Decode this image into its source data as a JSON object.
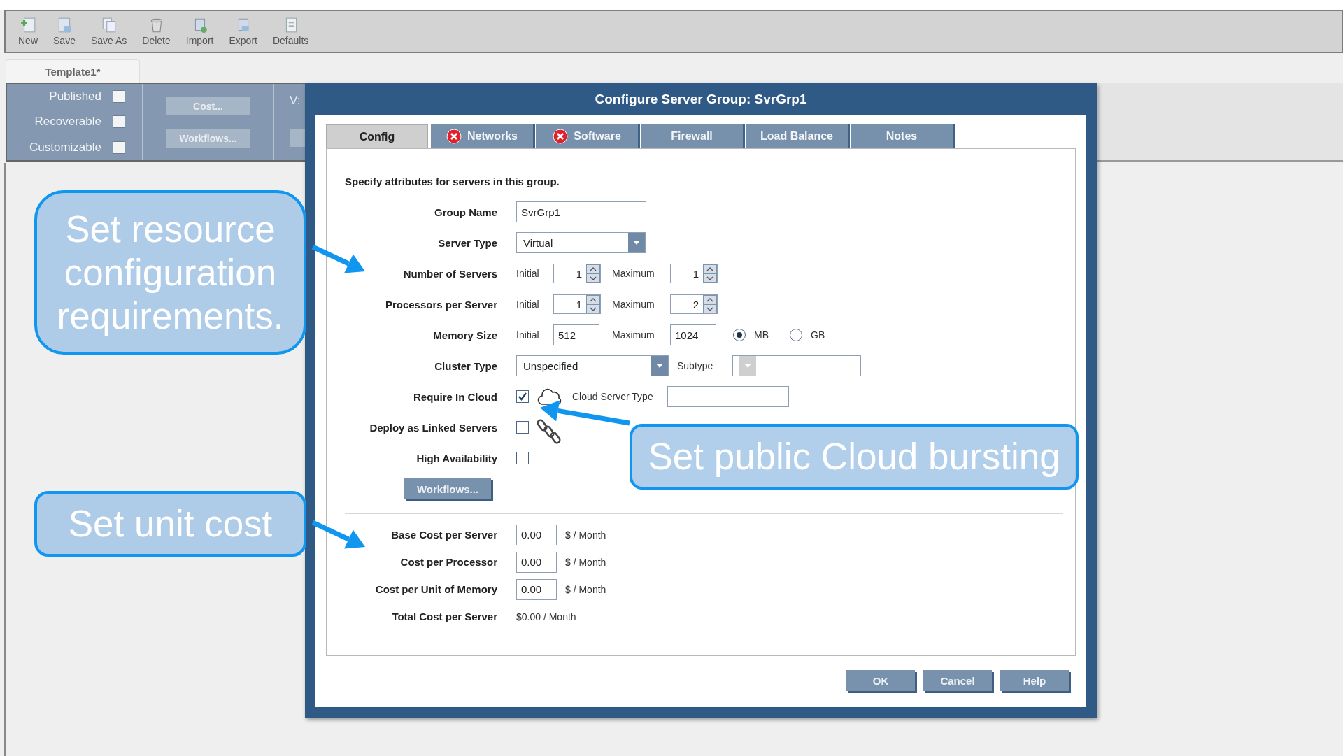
{
  "toolbar": [
    {
      "label": "New"
    },
    {
      "label": "Save"
    },
    {
      "label": "Save As"
    },
    {
      "label": "Delete"
    },
    {
      "label": "Import"
    },
    {
      "label": "Export"
    },
    {
      "label": "Defaults"
    }
  ],
  "document_tabs": [
    {
      "label": "Template1*",
      "selected": true
    }
  ],
  "properties_panel": {
    "checkboxes": [
      {
        "label": "Published",
        "checked": false
      },
      {
        "label": "Recoverable",
        "checked": false
      },
      {
        "label": "Customizable",
        "checked": false
      }
    ],
    "buttons": [
      "Cost...",
      "Workflows..."
    ],
    "column_3_label": "V:"
  },
  "dialog": {
    "title": "Configure Server Group: SvrGrp1",
    "tabs": [
      {
        "label": "Config",
        "selected": true,
        "error": false
      },
      {
        "label": "Networks",
        "selected": false,
        "error": true
      },
      {
        "label": "Software",
        "selected": false,
        "error": true
      },
      {
        "label": "Firewall",
        "selected": false,
        "error": false
      },
      {
        "label": "Load Balance",
        "selected": false,
        "error": false
      },
      {
        "label": "Notes",
        "selected": false,
        "error": false
      }
    ],
    "intro": "Specify attributes for servers in this group.",
    "rows": [
      {
        "kind": "text",
        "label": "Group Name",
        "value": "SvrGrp1"
      },
      {
        "kind": "select",
        "label": "Server Type",
        "value": "Virtual"
      },
      {
        "kind": "range",
        "label": "Number of Servers",
        "initial_label": "Initial",
        "initial": "1",
        "max_label": "Maximum",
        "maximum": "1"
      },
      {
        "kind": "range",
        "label": "Processors per Server",
        "initial_label": "Initial",
        "initial": "1",
        "max_label": "Maximum",
        "maximum": "2"
      },
      {
        "kind": "memory",
        "label": "Memory Size",
        "initial_label": "Initial",
        "initial": "512",
        "max_label": "Maximum",
        "maximum": "1024",
        "units": [
          {
            "label": "MB",
            "selected": true
          },
          {
            "label": "GB",
            "selected": false
          }
        ]
      },
      {
        "kind": "cluster",
        "label": "Cluster Type",
        "value": "Unspecified",
        "subtype_label": "Subtype"
      },
      {
        "kind": "cloud",
        "label": "Require In Cloud",
        "checked": true,
        "extra_label": "Cloud Server Type"
      },
      {
        "kind": "linked",
        "label": "Deploy as Linked Servers",
        "checked": false
      },
      {
        "kind": "check",
        "label": "High Availability",
        "checked": false
      },
      {
        "kind": "button",
        "label": "Workflows..."
      }
    ],
    "cost_rows": [
      {
        "label": "Base Cost per Server",
        "value": "0.00",
        "unit": "$ / Month"
      },
      {
        "label": "Cost per Processor",
        "value": "0.00",
        "unit": "$ / Month"
      },
      {
        "label": "Cost per Unit of Memory",
        "value": "0.00",
        "unit": "$ / Month"
      }
    ],
    "total": {
      "label": "Total Cost per Server",
      "value": "$0.00 / Month"
    },
    "buttons": [
      "OK",
      "Cancel",
      "Help"
    ]
  },
  "callouts": [
    {
      "text": "Set resource configuration requirements."
    },
    {
      "text": "Set unit cost"
    },
    {
      "text": "Set public Cloud bursting"
    }
  ]
}
